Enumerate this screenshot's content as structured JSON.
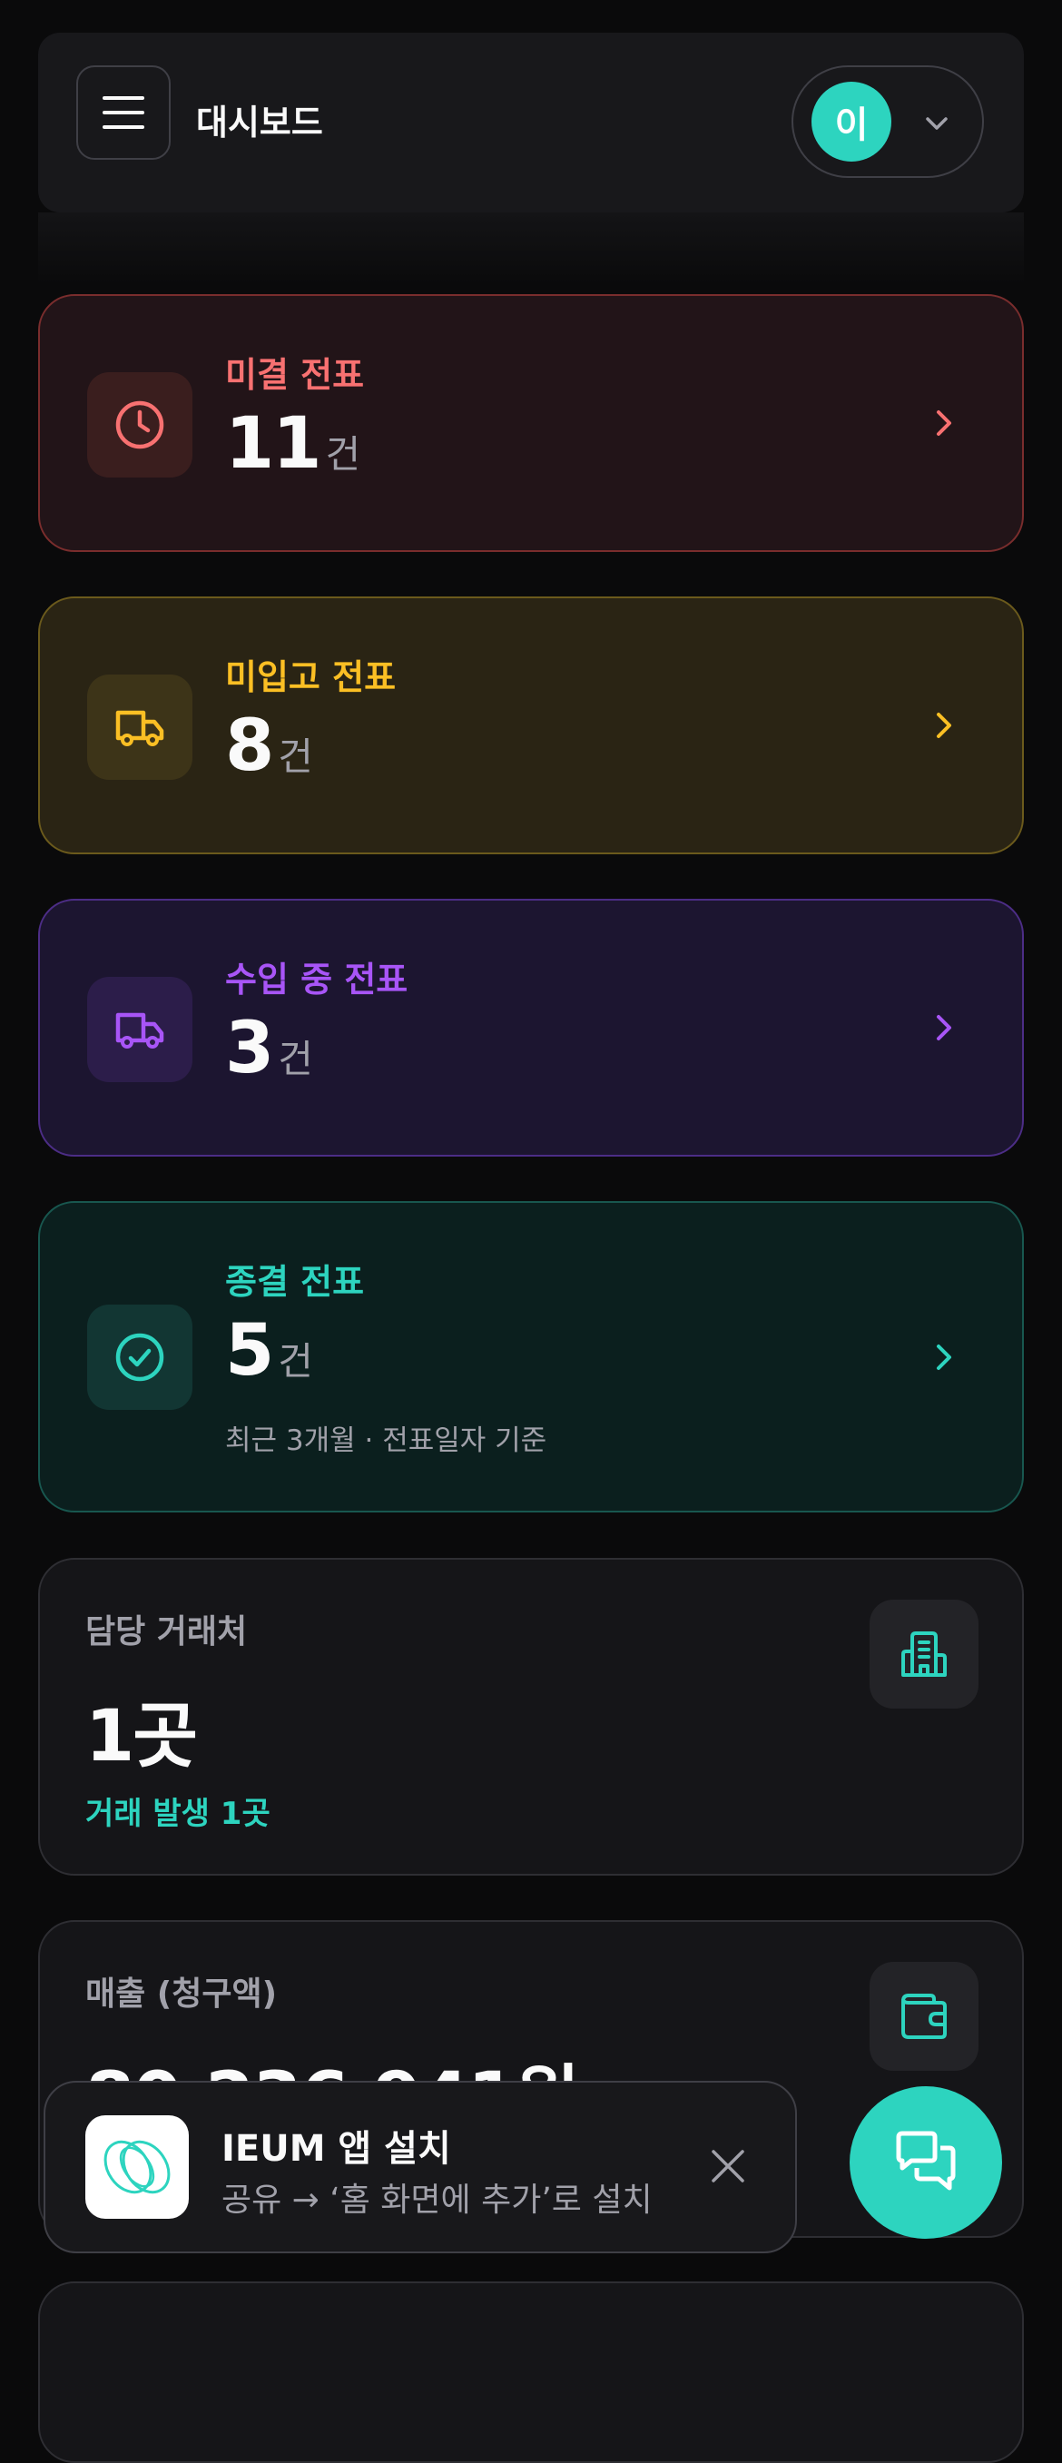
{
  "header": {
    "title": "대시보드",
    "avatar_initial": "이"
  },
  "status_cards": [
    {
      "label": "미결 전표",
      "count": "11",
      "unit": "건",
      "color": "#f87171",
      "icon": "clock-icon"
    },
    {
      "label": "미입고 전표",
      "count": "8",
      "unit": "건",
      "color": "#fbbf24",
      "icon": "truck-icon"
    },
    {
      "label": "수입 중 전표",
      "count": "3",
      "unit": "건",
      "color": "#a855f7",
      "icon": "truck-icon"
    },
    {
      "label": "종결 전표",
      "count": "5",
      "unit": "건",
      "color": "#2dd4bf",
      "icon": "check-circle-icon",
      "note": "최근 3개월 · 전표일자 기준"
    }
  ],
  "partners": {
    "label": "담당 거래처",
    "value": "1곳",
    "sub": "거래 발생 1곳",
    "icon": "building-icon"
  },
  "sales": {
    "label": "매출 (청구액)",
    "value": "80,236,941원",
    "icon": "wallet-icon"
  },
  "install_banner": {
    "title": "IEUM 앱 설치",
    "subtitle": "공유 → ‘홈 화면에 추가’로 설치"
  },
  "colors": {
    "accent": "#2dd4bf",
    "background": "#0a0a0b"
  }
}
